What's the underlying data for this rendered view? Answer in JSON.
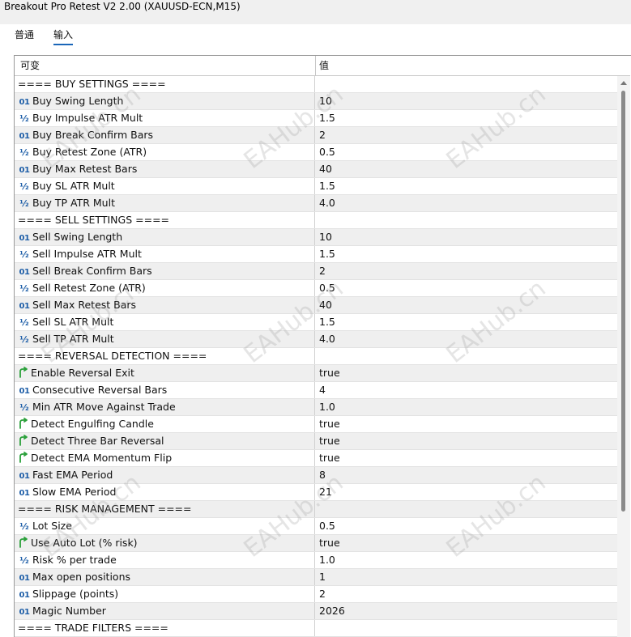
{
  "window": {
    "title": "Breakout Pro Retest V2 2.00 (XAUUSD-ECN,M15)"
  },
  "tabs": [
    {
      "label": "普通",
      "active": false
    },
    {
      "label": "输入",
      "active": true
    }
  ],
  "table": {
    "columns": {
      "name": "可变",
      "value": "值"
    },
    "rows": [
      {
        "type": "section",
        "name": "==== BUY SETTINGS ====",
        "value": ""
      },
      {
        "type": "int",
        "name": "Buy Swing Length",
        "value": "10"
      },
      {
        "type": "double",
        "name": "Buy Impulse ATR Mult",
        "value": "1.5"
      },
      {
        "type": "int",
        "name": "Buy Break Confirm Bars",
        "value": "2"
      },
      {
        "type": "double",
        "name": "Buy Retest Zone (ATR)",
        "value": "0.5"
      },
      {
        "type": "int",
        "name": "Buy Max Retest Bars",
        "value": "40"
      },
      {
        "type": "double",
        "name": "Buy SL ATR Mult",
        "value": "1.5"
      },
      {
        "type": "double",
        "name": "Buy TP ATR Mult",
        "value": "4.0"
      },
      {
        "type": "section",
        "name": "==== SELL SETTINGS ====",
        "value": ""
      },
      {
        "type": "int",
        "name": "Sell Swing Length",
        "value": "10"
      },
      {
        "type": "double",
        "name": "Sell Impulse ATR Mult",
        "value": "1.5"
      },
      {
        "type": "int",
        "name": "Sell Break Confirm Bars",
        "value": "2"
      },
      {
        "type": "double",
        "name": "Sell Retest Zone (ATR)",
        "value": "0.5"
      },
      {
        "type": "int",
        "name": "Sell Max Retest Bars",
        "value": "40"
      },
      {
        "type": "double",
        "name": "Sell SL ATR Mult",
        "value": "1.5"
      },
      {
        "type": "double",
        "name": "Sell TP ATR Mult",
        "value": "4.0"
      },
      {
        "type": "section",
        "name": "==== REVERSAL DETECTION ====",
        "value": ""
      },
      {
        "type": "bool",
        "name": "Enable Reversal Exit",
        "value": "true"
      },
      {
        "type": "int",
        "name": "Consecutive Reversal Bars",
        "value": "4"
      },
      {
        "type": "double",
        "name": "Min ATR Move Against Trade",
        "value": "1.0"
      },
      {
        "type": "bool",
        "name": "Detect Engulfing Candle",
        "value": "true"
      },
      {
        "type": "bool",
        "name": "Detect Three Bar Reversal",
        "value": "true"
      },
      {
        "type": "bool",
        "name": "Detect EMA Momentum Flip",
        "value": "true"
      },
      {
        "type": "int",
        "name": "Fast EMA Period",
        "value": "8"
      },
      {
        "type": "int",
        "name": "Slow EMA Period",
        "value": "21"
      },
      {
        "type": "section",
        "name": "==== RISK MANAGEMENT ====",
        "value": ""
      },
      {
        "type": "double",
        "name": "Lot Size",
        "value": "0.5"
      },
      {
        "type": "bool",
        "name": "Use Auto Lot (% risk)",
        "value": "true"
      },
      {
        "type": "double",
        "name": "Risk % per trade",
        "value": "1.0"
      },
      {
        "type": "int",
        "name": "Max open positions",
        "value": "1"
      },
      {
        "type": "int",
        "name": "Slippage (points)",
        "value": "2"
      },
      {
        "type": "int",
        "name": "Magic Number",
        "value": "2026"
      },
      {
        "type": "section",
        "name": "==== TRADE FILTERS ====",
        "value": ""
      }
    ]
  },
  "icons": {
    "int": "01",
    "double": "½",
    "bool": "bool-arrow-icon"
  },
  "colors": {
    "accent": "#1a66b8",
    "bool_icon": "#2aa03a",
    "type_icon": "#1f5fa8"
  },
  "watermark": {
    "text": "EAHub.cn"
  }
}
